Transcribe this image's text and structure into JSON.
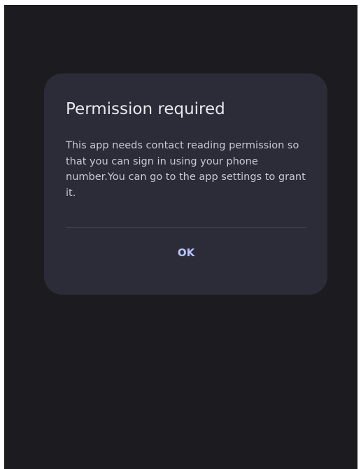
{
  "dialog": {
    "title": "Permission required",
    "message": "This app needs contact reading permission so that you can sign in using your phone number.You can go to the app settings to grant it.",
    "ok_label": "OK"
  },
  "colors": {
    "background": "#1c1c20",
    "dialog_surface": "#2b2c38",
    "title_text": "#e8e8ef",
    "body_text": "#c9c9d3",
    "button_text": "#b8c4ff",
    "divider": "#4b4c58"
  }
}
